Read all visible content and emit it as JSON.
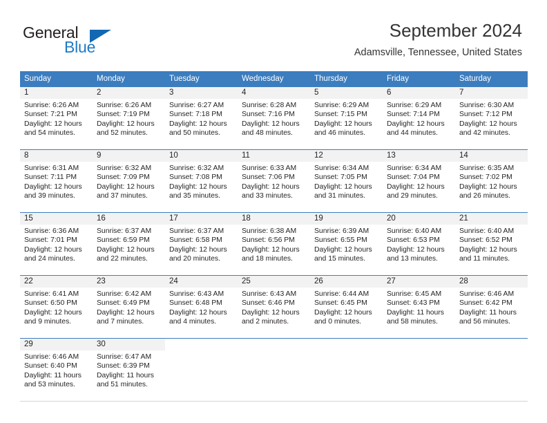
{
  "brand": {
    "name_part1": "General",
    "name_part2": "Blue",
    "logo_icon": "triangle-logo-icon"
  },
  "header": {
    "title": "September 2024",
    "subtitle": "Adamsville, Tennessee, United States"
  },
  "colors": {
    "header_blue": "#3b7dbf",
    "brand_blue": "#1268b3",
    "daynum_band": "#f2f2f2",
    "text": "#231f20"
  },
  "weekday_headers": [
    "Sunday",
    "Monday",
    "Tuesday",
    "Wednesday",
    "Thursday",
    "Friday",
    "Saturday"
  ],
  "weeks": [
    [
      {
        "day": "1",
        "sunrise": "Sunrise: 6:26 AM",
        "sunset": "Sunset: 7:21 PM",
        "daylight_1": "Daylight: 12 hours",
        "daylight_2": "and 54 minutes."
      },
      {
        "day": "2",
        "sunrise": "Sunrise: 6:26 AM",
        "sunset": "Sunset: 7:19 PM",
        "daylight_1": "Daylight: 12 hours",
        "daylight_2": "and 52 minutes."
      },
      {
        "day": "3",
        "sunrise": "Sunrise: 6:27 AM",
        "sunset": "Sunset: 7:18 PM",
        "daylight_1": "Daylight: 12 hours",
        "daylight_2": "and 50 minutes."
      },
      {
        "day": "4",
        "sunrise": "Sunrise: 6:28 AM",
        "sunset": "Sunset: 7:16 PM",
        "daylight_1": "Daylight: 12 hours",
        "daylight_2": "and 48 minutes."
      },
      {
        "day": "5",
        "sunrise": "Sunrise: 6:29 AM",
        "sunset": "Sunset: 7:15 PM",
        "daylight_1": "Daylight: 12 hours",
        "daylight_2": "and 46 minutes."
      },
      {
        "day": "6",
        "sunrise": "Sunrise: 6:29 AM",
        "sunset": "Sunset: 7:14 PM",
        "daylight_1": "Daylight: 12 hours",
        "daylight_2": "and 44 minutes."
      },
      {
        "day": "7",
        "sunrise": "Sunrise: 6:30 AM",
        "sunset": "Sunset: 7:12 PM",
        "daylight_1": "Daylight: 12 hours",
        "daylight_2": "and 42 minutes."
      }
    ],
    [
      {
        "day": "8",
        "sunrise": "Sunrise: 6:31 AM",
        "sunset": "Sunset: 7:11 PM",
        "daylight_1": "Daylight: 12 hours",
        "daylight_2": "and 39 minutes."
      },
      {
        "day": "9",
        "sunrise": "Sunrise: 6:32 AM",
        "sunset": "Sunset: 7:09 PM",
        "daylight_1": "Daylight: 12 hours",
        "daylight_2": "and 37 minutes."
      },
      {
        "day": "10",
        "sunrise": "Sunrise: 6:32 AM",
        "sunset": "Sunset: 7:08 PM",
        "daylight_1": "Daylight: 12 hours",
        "daylight_2": "and 35 minutes."
      },
      {
        "day": "11",
        "sunrise": "Sunrise: 6:33 AM",
        "sunset": "Sunset: 7:06 PM",
        "daylight_1": "Daylight: 12 hours",
        "daylight_2": "and 33 minutes."
      },
      {
        "day": "12",
        "sunrise": "Sunrise: 6:34 AM",
        "sunset": "Sunset: 7:05 PM",
        "daylight_1": "Daylight: 12 hours",
        "daylight_2": "and 31 minutes."
      },
      {
        "day": "13",
        "sunrise": "Sunrise: 6:34 AM",
        "sunset": "Sunset: 7:04 PM",
        "daylight_1": "Daylight: 12 hours",
        "daylight_2": "and 29 minutes."
      },
      {
        "day": "14",
        "sunrise": "Sunrise: 6:35 AM",
        "sunset": "Sunset: 7:02 PM",
        "daylight_1": "Daylight: 12 hours",
        "daylight_2": "and 26 minutes."
      }
    ],
    [
      {
        "day": "15",
        "sunrise": "Sunrise: 6:36 AM",
        "sunset": "Sunset: 7:01 PM",
        "daylight_1": "Daylight: 12 hours",
        "daylight_2": "and 24 minutes."
      },
      {
        "day": "16",
        "sunrise": "Sunrise: 6:37 AM",
        "sunset": "Sunset: 6:59 PM",
        "daylight_1": "Daylight: 12 hours",
        "daylight_2": "and 22 minutes."
      },
      {
        "day": "17",
        "sunrise": "Sunrise: 6:37 AM",
        "sunset": "Sunset: 6:58 PM",
        "daylight_1": "Daylight: 12 hours",
        "daylight_2": "and 20 minutes."
      },
      {
        "day": "18",
        "sunrise": "Sunrise: 6:38 AM",
        "sunset": "Sunset: 6:56 PM",
        "daylight_1": "Daylight: 12 hours",
        "daylight_2": "and 18 minutes."
      },
      {
        "day": "19",
        "sunrise": "Sunrise: 6:39 AM",
        "sunset": "Sunset: 6:55 PM",
        "daylight_1": "Daylight: 12 hours",
        "daylight_2": "and 15 minutes."
      },
      {
        "day": "20",
        "sunrise": "Sunrise: 6:40 AM",
        "sunset": "Sunset: 6:53 PM",
        "daylight_1": "Daylight: 12 hours",
        "daylight_2": "and 13 minutes."
      },
      {
        "day": "21",
        "sunrise": "Sunrise: 6:40 AM",
        "sunset": "Sunset: 6:52 PM",
        "daylight_1": "Daylight: 12 hours",
        "daylight_2": "and 11 minutes."
      }
    ],
    [
      {
        "day": "22",
        "sunrise": "Sunrise: 6:41 AM",
        "sunset": "Sunset: 6:50 PM",
        "daylight_1": "Daylight: 12 hours",
        "daylight_2": "and 9 minutes."
      },
      {
        "day": "23",
        "sunrise": "Sunrise: 6:42 AM",
        "sunset": "Sunset: 6:49 PM",
        "daylight_1": "Daylight: 12 hours",
        "daylight_2": "and 7 minutes."
      },
      {
        "day": "24",
        "sunrise": "Sunrise: 6:43 AM",
        "sunset": "Sunset: 6:48 PM",
        "daylight_1": "Daylight: 12 hours",
        "daylight_2": "and 4 minutes."
      },
      {
        "day": "25",
        "sunrise": "Sunrise: 6:43 AM",
        "sunset": "Sunset: 6:46 PM",
        "daylight_1": "Daylight: 12 hours",
        "daylight_2": "and 2 minutes."
      },
      {
        "day": "26",
        "sunrise": "Sunrise: 6:44 AM",
        "sunset": "Sunset: 6:45 PM",
        "daylight_1": "Daylight: 12 hours",
        "daylight_2": "and 0 minutes."
      },
      {
        "day": "27",
        "sunrise": "Sunrise: 6:45 AM",
        "sunset": "Sunset: 6:43 PM",
        "daylight_1": "Daylight: 11 hours",
        "daylight_2": "and 58 minutes."
      },
      {
        "day": "28",
        "sunrise": "Sunrise: 6:46 AM",
        "sunset": "Sunset: 6:42 PM",
        "daylight_1": "Daylight: 11 hours",
        "daylight_2": "and 56 minutes."
      }
    ],
    [
      {
        "day": "29",
        "sunrise": "Sunrise: 6:46 AM",
        "sunset": "Sunset: 6:40 PM",
        "daylight_1": "Daylight: 11 hours",
        "daylight_2": "and 53 minutes."
      },
      {
        "day": "30",
        "sunrise": "Sunrise: 6:47 AM",
        "sunset": "Sunset: 6:39 PM",
        "daylight_1": "Daylight: 11 hours",
        "daylight_2": "and 51 minutes."
      },
      {
        "day": "",
        "sunrise": "",
        "sunset": "",
        "daylight_1": "",
        "daylight_2": ""
      },
      {
        "day": "",
        "sunrise": "",
        "sunset": "",
        "daylight_1": "",
        "daylight_2": ""
      },
      {
        "day": "",
        "sunrise": "",
        "sunset": "",
        "daylight_1": "",
        "daylight_2": ""
      },
      {
        "day": "",
        "sunrise": "",
        "sunset": "",
        "daylight_1": "",
        "daylight_2": ""
      },
      {
        "day": "",
        "sunrise": "",
        "sunset": "",
        "daylight_1": "",
        "daylight_2": ""
      }
    ]
  ]
}
